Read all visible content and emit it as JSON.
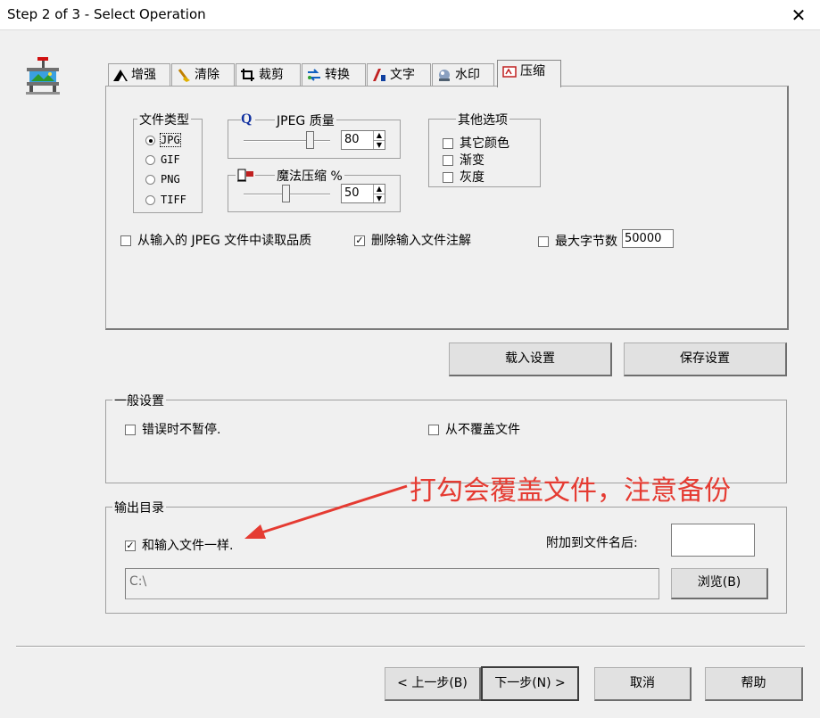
{
  "window": {
    "title": "Step 2 of 3 - Select Operation",
    "close_glyph": "✕"
  },
  "tabs": [
    {
      "label": "增强",
      "icon": "enhance-icon"
    },
    {
      "label": "清除",
      "icon": "clean-icon"
    },
    {
      "label": "裁剪",
      "icon": "crop-icon"
    },
    {
      "label": "转换",
      "icon": "convert-icon"
    },
    {
      "label": "文字",
      "icon": "text-icon"
    },
    {
      "label": "水印",
      "icon": "watermark-icon"
    },
    {
      "label": "压缩",
      "icon": "compress-icon",
      "active": true
    }
  ],
  "compress": {
    "file_type": {
      "label": "文件类型",
      "options": [
        "JPG",
        "GIF",
        "PNG",
        "TIFF"
      ],
      "selected": "JPG"
    },
    "jpeg_quality": {
      "label": "JPEG 质量",
      "value": "80",
      "icon_glyph": "Q"
    },
    "magic_compress": {
      "label": "魔法压缩 %",
      "value": "50"
    },
    "other_options": {
      "label": "其他选项",
      "items": [
        {
          "label": "其它颜色",
          "checked": false
        },
        {
          "label": "渐变",
          "checked": false
        },
        {
          "label": "灰度",
          "checked": false
        }
      ]
    },
    "read_quality": {
      "label": "从输入的 JPEG 文件中读取品质",
      "checked": false
    },
    "delete_comments": {
      "label": "删除输入文件注解",
      "checked": true
    },
    "max_bytes": {
      "label": "最大字节数",
      "checked": false,
      "value": "50000"
    }
  },
  "settings_buttons": {
    "load": "载入设置",
    "save": "保存设置"
  },
  "general": {
    "label": "一般设置",
    "no_pause": {
      "label": "错误时不暂停.",
      "checked": false
    },
    "no_overwrite": {
      "label": "从不覆盖文件",
      "checked": false
    }
  },
  "output": {
    "label": "输出目录",
    "same_as_input": {
      "label": "和输入文件一样.",
      "checked": true
    },
    "append_label": "附加到文件名后:",
    "append_value": "",
    "path": "C:\\",
    "browse": "浏览(B)"
  },
  "annotation": {
    "text": "打勾会覆盖文件，注意备份",
    "color": "#e53b32"
  },
  "footer": {
    "back": "< 上一步(B)",
    "next": "下一步(N) >",
    "cancel": "取消",
    "help": "帮助"
  },
  "check_glyph": "✓"
}
